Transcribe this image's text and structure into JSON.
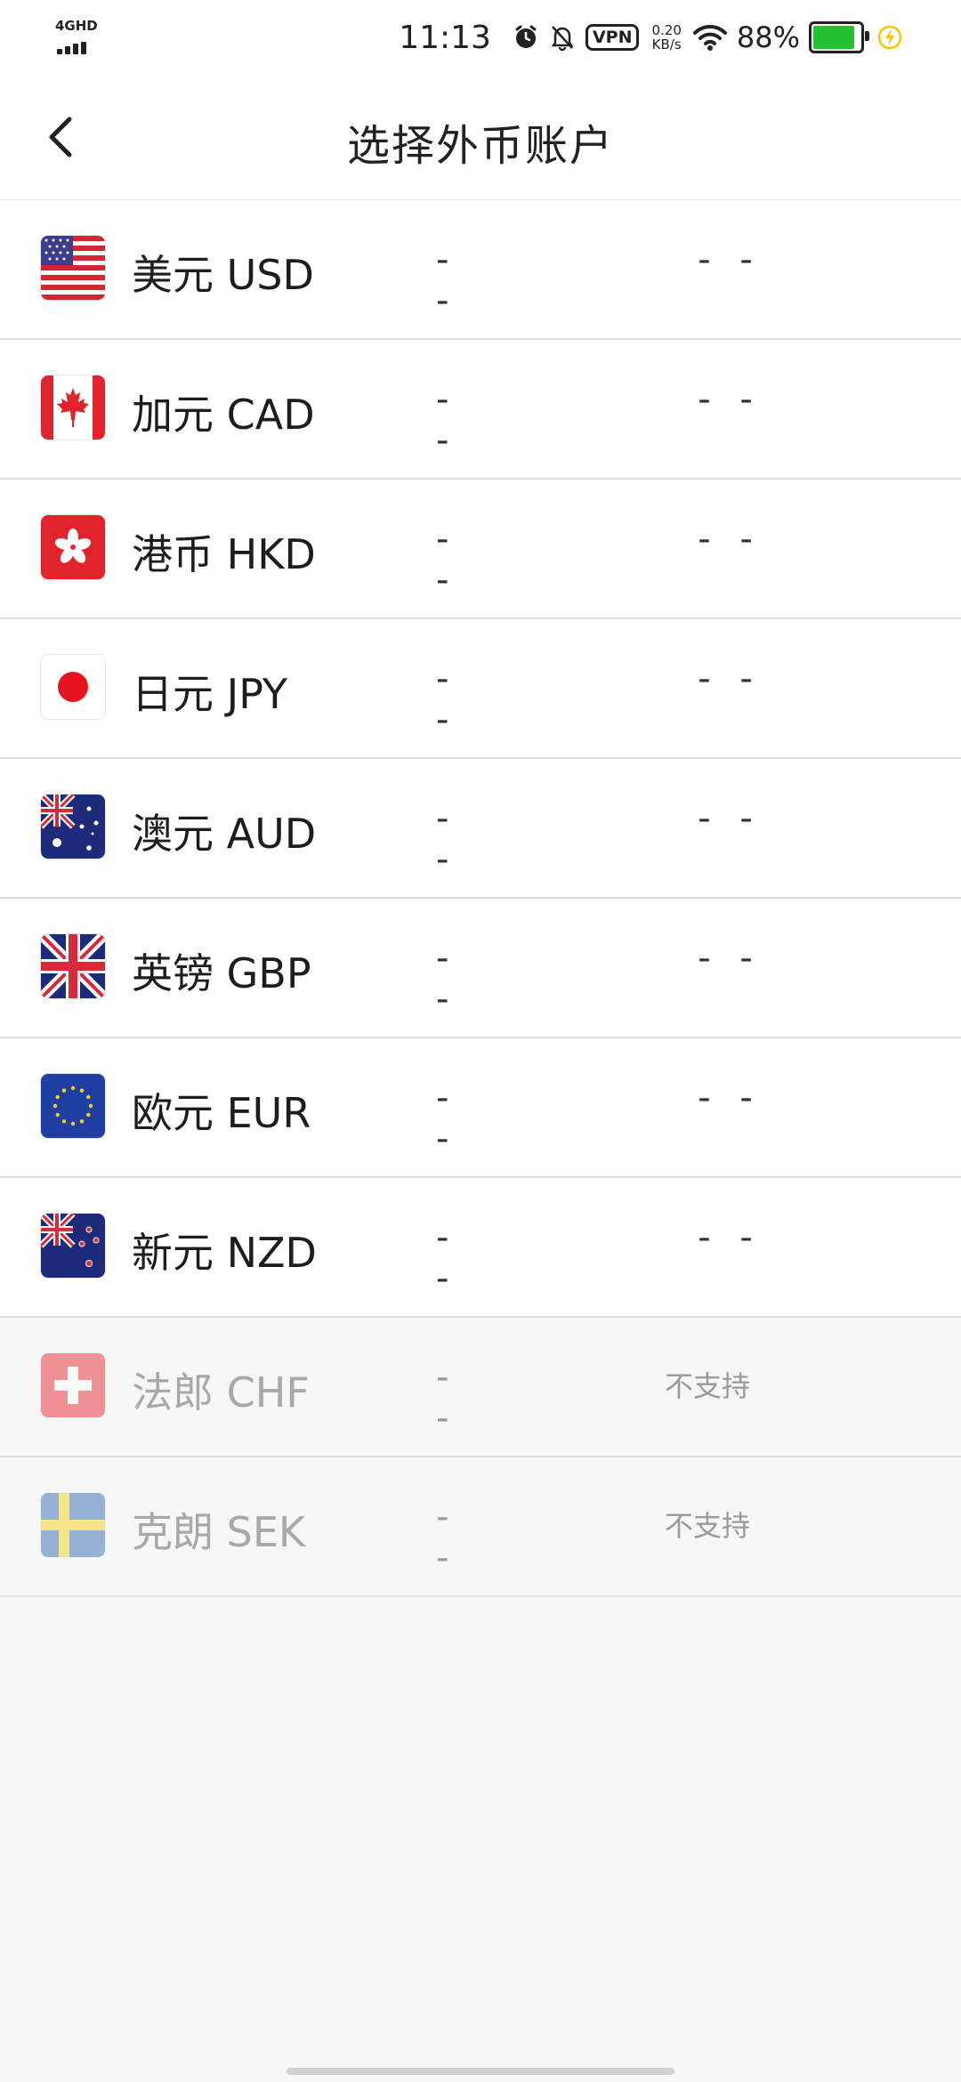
{
  "status_bar": {
    "network": "4GHD",
    "time": "11:13",
    "vpn": "VPN",
    "speed_value": "0.20",
    "speed_unit": "KB/s",
    "battery_percent": "88%",
    "battery_level": 0.88,
    "icons": [
      "alarm-icon",
      "bell-off-icon",
      "wifi-icon",
      "battery-icon",
      "charging-icon"
    ]
  },
  "header": {
    "title": "选择外币账户",
    "back_icon": "chevron-left-icon"
  },
  "currencies": [
    {
      "name": "美元 USD",
      "balance": "- -",
      "status": "- -",
      "enabled": true,
      "flag": "us-flag-icon"
    },
    {
      "name": "加元 CAD",
      "balance": "- -",
      "status": "- -",
      "enabled": true,
      "flag": "canada-flag-icon"
    },
    {
      "name": "港币 HKD",
      "balance": "- -",
      "status": "- -",
      "enabled": true,
      "flag": "hong-kong-flag-icon"
    },
    {
      "name": "日元 JPY",
      "balance": "- -",
      "status": "- -",
      "enabled": true,
      "flag": "japan-flag-icon"
    },
    {
      "name": "澳元 AUD",
      "balance": "- -",
      "status": "- -",
      "enabled": true,
      "flag": "australia-flag-icon"
    },
    {
      "name": "英镑 GBP",
      "balance": "- -",
      "status": "- -",
      "enabled": true,
      "flag": "uk-flag-icon"
    },
    {
      "name": "欧元 EUR",
      "balance": "- -",
      "status": "- -",
      "enabled": true,
      "flag": "eu-flag-icon"
    },
    {
      "name": "新元 NZD",
      "balance": "- -",
      "status": "- -",
      "enabled": true,
      "flag": "new-zealand-flag-icon"
    },
    {
      "name": "法郎 CHF",
      "balance": "- -",
      "status": "不支持",
      "enabled": false,
      "flag": "switzerland-flag-icon"
    },
    {
      "name": "克朗 SEK",
      "balance": "- -",
      "status": "不支持",
      "enabled": false,
      "flag": "sweden-flag-icon"
    }
  ],
  "colors": {
    "battery_fill": "#22c232",
    "charging": "#f5c800",
    "background": "#f7f7f7"
  }
}
